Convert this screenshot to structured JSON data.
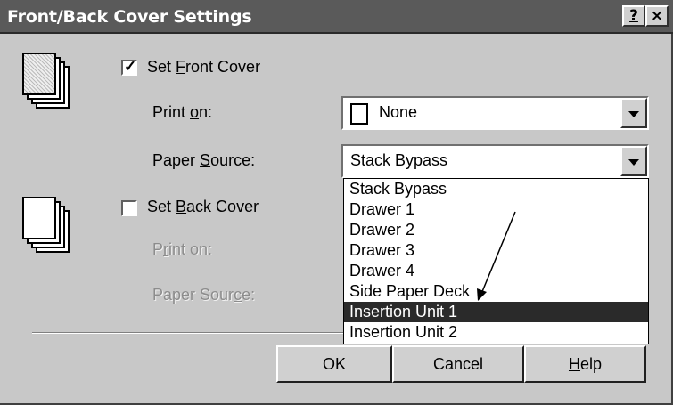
{
  "window": {
    "title": "Front/Back Cover Settings",
    "help_button": "?",
    "close_button": "×"
  },
  "front_cover": {
    "checkbox_label_pre": "Set ",
    "checkbox_label_accel": "F",
    "checkbox_label_post": "ront Cover",
    "checked": true,
    "print_on_label_pre": "Print ",
    "print_on_label_accel": "o",
    "print_on_label_post": "n:",
    "print_on_value": "None",
    "paper_source_label_pre": "Paper ",
    "paper_source_label_accel": "S",
    "paper_source_label_post": "ource:",
    "paper_source_value": "Stack Bypass"
  },
  "back_cover": {
    "checkbox_label_pre": "Set ",
    "checkbox_label_accel": "B",
    "checkbox_label_post": "ack Cover",
    "checked": false,
    "print_on_label_pre": "P",
    "print_on_label_accel": "r",
    "print_on_label_post": "int on:",
    "paper_source_label_pre": "Paper Sour",
    "paper_source_label_accel": "c",
    "paper_source_label_post": "e:"
  },
  "paper_source_dropdown": {
    "options": [
      "Stack Bypass",
      "Drawer 1",
      "Drawer 2",
      "Drawer 3",
      "Drawer 4",
      "Side Paper Deck",
      "Insertion Unit 1",
      "Insertion Unit 2"
    ],
    "highlighted_index": 6
  },
  "buttons": {
    "ok": "OK",
    "cancel": "Cancel",
    "help_pre": "",
    "help_accel": "H",
    "help_post": "elp"
  },
  "colors": {
    "dialog_bg": "#c8c8c8",
    "titlebar_bg": "#5a5a5a",
    "highlight_bg": "#2a2a2a",
    "disabled_text": "#8c8c8c"
  }
}
